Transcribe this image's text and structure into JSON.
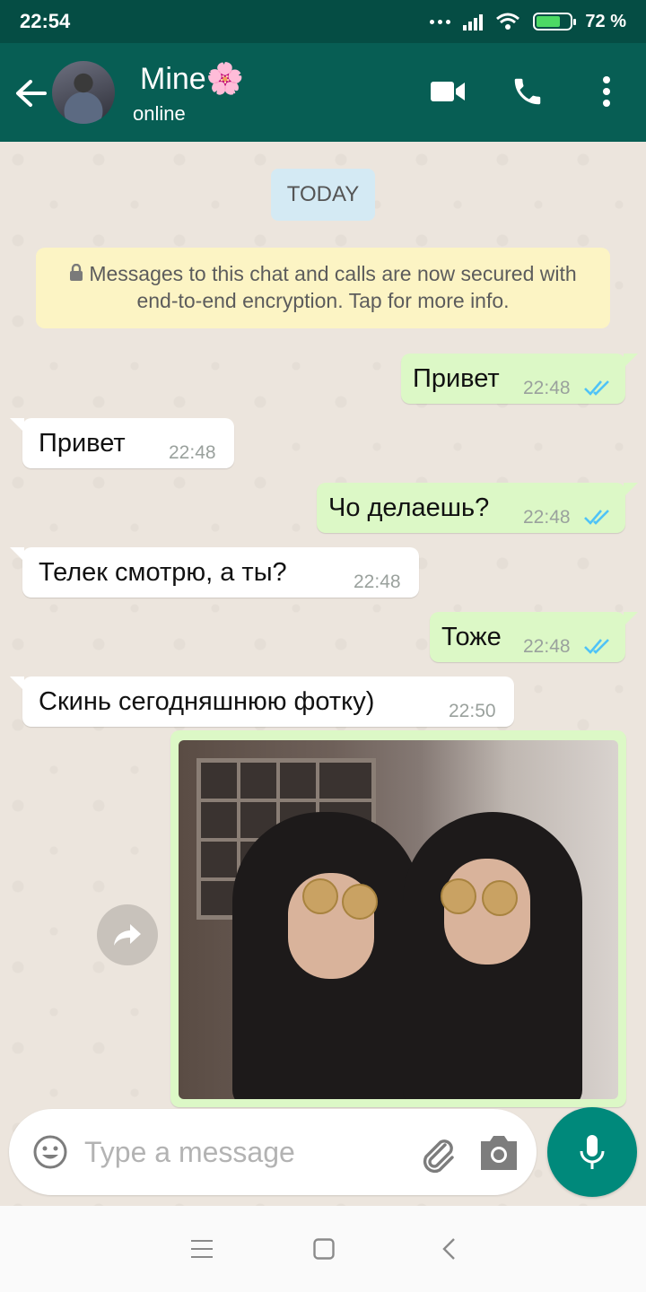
{
  "status_bar": {
    "time": "22:54",
    "battery": "72 %",
    "battery_level": 0.72
  },
  "header": {
    "name": "Mine🌸",
    "status": "online",
    "icons": [
      "back-arrow-icon",
      "video-call-icon",
      "phone-icon",
      "more-options-icon"
    ]
  },
  "chat": {
    "date_label": "TODAY",
    "encryption_notice": "Messages to this chat and calls are now secured with end-to-end encryption. Tap for more info.",
    "messages": [
      {
        "direction": "out",
        "text": "Привет",
        "time": "22:48",
        "status": "read"
      },
      {
        "direction": "in",
        "text": "Привет",
        "time": "22:48"
      },
      {
        "direction": "out",
        "text": "Чо делаешь?",
        "time": "22:48",
        "status": "read"
      },
      {
        "direction": "in",
        "text": "Телек смотрю, а ты?",
        "time": "22:48"
      },
      {
        "direction": "out",
        "text": "Тоже",
        "time": "22:48",
        "status": "read"
      },
      {
        "direction": "in",
        "text": "Скинь сегодняшнюю фотку)",
        "time": "22:50"
      }
    ],
    "photo_message": {
      "direction": "out"
    }
  },
  "composer": {
    "placeholder": "Type a message"
  },
  "colors": {
    "header": "#075e54",
    "status_bar": "#054d44",
    "outgoing": "#dcf8c6",
    "incoming": "#ffffff",
    "accent": "#00897b",
    "read_ticks": "#4fc3f7"
  }
}
